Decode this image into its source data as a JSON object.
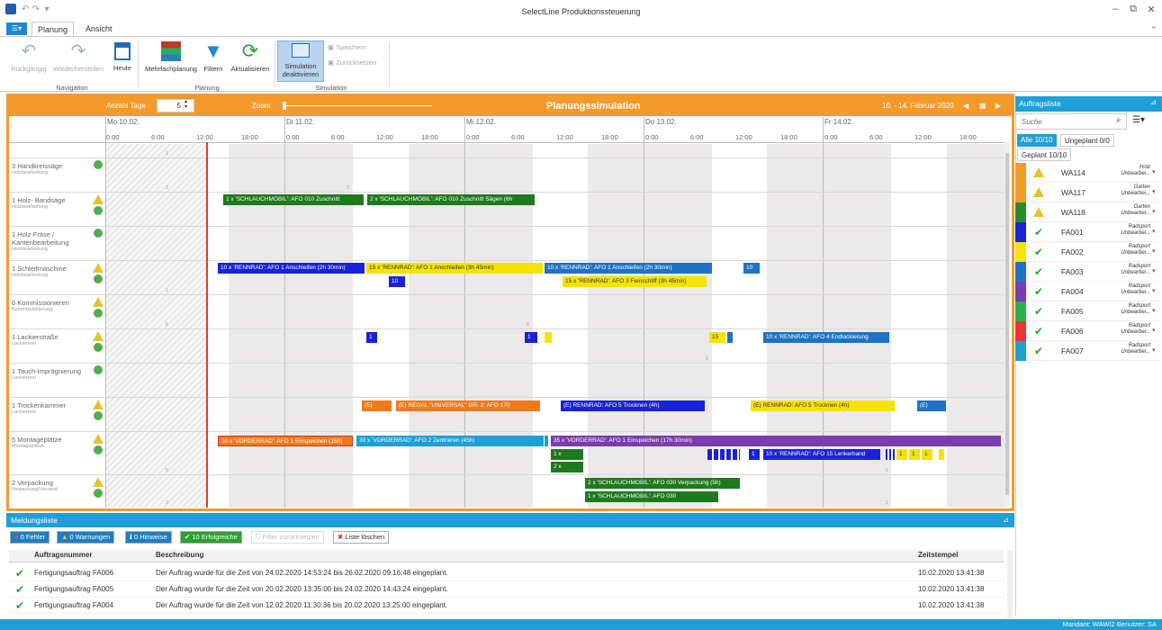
{
  "app": {
    "title": "SelectLine Produktionssteuerung"
  },
  "tabs": [
    "Planung",
    "Ansicht"
  ],
  "ribbon": {
    "nav": {
      "undo": "Rückgängig",
      "redo": "Wiederherstellen",
      "today": "Heute",
      "label": "Navigation"
    },
    "plan": {
      "multi": "Mehrfachplanung",
      "filter": "Filtern",
      "refresh": "Aktualisieren",
      "label": "Planung"
    },
    "sim": {
      "deactivate_1": "Simulation",
      "deactivate_2": "deaktivieren",
      "save": "Speichern",
      "reset": "Zurücksetzen",
      "label": "Simulation"
    }
  },
  "planner": {
    "days_label": "Anzahl Tage",
    "days_value": "5",
    "zoom_label": "Zoom",
    "title": "Planungssimulation",
    "range": "10. - 14. Februar 2020",
    "days": [
      "Mo 10.02.",
      "Di 11.02.",
      "Mi 12.02.",
      "Do 13.02.",
      "Fr 14.02."
    ],
    "hours": [
      "0:00",
      "6:00",
      "12:00",
      "18:00"
    ]
  },
  "resources": [
    {
      "name": "3 Handkreissäge",
      "group": "Holzbearbeitung",
      "status": "ok"
    },
    {
      "name": "1 Holz- Bandsäge",
      "group": "Holzbearbeitung",
      "status": "warn"
    },
    {
      "name": "1 Holz-Fräse / Kantenbearbeitung",
      "group": "Holzbearbeitung",
      "status": "ok"
    },
    {
      "name": "1 Schleifmaschine",
      "group": "Holzbearbeitung",
      "status": "warn"
    },
    {
      "name": "6 Kommissionieren",
      "group": "Kommissionierung",
      "status": "warn"
    },
    {
      "name": "1 Lackierstraße",
      "group": "Lackiererei",
      "status": "warn"
    },
    {
      "name": "1 Tauch-Imprägnierung",
      "group": "Lackiererei",
      "status": "ok"
    },
    {
      "name": "1 Trockenkammer",
      "group": "Lackiererei",
      "status": "warn"
    },
    {
      "name": "5 Montageplätze",
      "group": "Montageplätze",
      "status": "warn"
    },
    {
      "name": "2 Verpackung",
      "group": "Verpackung/Versand",
      "status": "warn"
    }
  ],
  "bars": {
    "b1": "1 x 'SCHLAUCHMOBIL': AFO 010 Zuschnitt",
    "b2": "2 x 'SCHLAUCHMOBIL': AFO 010 Zuschnitt Sägen (6h",
    "b3": "10 x 'RENNRAD': AFO 1 Anschleifen (2h 30min)",
    "b4": "15 x 'RENNRAD': AFO 1 Anschleifen (3h 45min)",
    "b5": "10 x 'RENNRAD': AFO 1 Anschleifen (2h 30min)",
    "b6": "10",
    "b7": "10",
    "b8": "15 x 'RENNRAD': AFO 3 Feinschliff (3h 45min)",
    "b9": "1",
    "b10": "1",
    "b11": "15",
    "b12": "10 x 'RENNRAD': AFO 4 Endlackierung",
    "b13": "(E)",
    "b14": "(E) REGAL \"UNIVERSAL\" GR. 2: AFO 170",
    "b15": "(E) RENNRAD: AFO 5 Trocknen (4h)",
    "b16": "(E) RENNRAD: AFO 5 Trocknen (4h)",
    "b17": "(E)",
    "b18": "30 x 'VORDERRAD': AFO 1 Einspeichen (15h)",
    "b19": "30 x 'VORDERRAD': AFO 2 Zentrieren (45h)",
    "b20": "35 x 'VORDERRAD': AFO 1 Einspeichen (17h 30min)",
    "b21": "1 x",
    "b22": "2 x",
    "b23": "1",
    "b24": "10 x 'RENNRAD': AFO 15 Lenkerband",
    "b25": "1",
    "b26": "1",
    "b27": "1",
    "b28": "2 x 'SCHLAUCHMOBIL': AFO 030 Verpackung (5h)",
    "b29": "1 x 'SCHLAUCHMOBIL': AFO 030"
  },
  "ticks": {
    "t_one": "1",
    "t_three": "3",
    "t_six": "6",
    "t_five": "5",
    "t_two": "2"
  },
  "orders": {
    "title": "Auftragsliste",
    "search_placeholder": "Suche",
    "filter_all": "Alle 10/10",
    "filter_unplanned": "Ungeplant 0/0",
    "filter_planned": "Geplant 10/10",
    "items": [
      {
        "code": "WA114",
        "cat": "Holz",
        "sub": "Unbearbei...",
        "status": "warn",
        "color": "#f39a2b"
      },
      {
        "code": "WA117",
        "cat": "Garten",
        "sub": "Unbearbei...",
        "status": "warn",
        "color": "#f39a2b"
      },
      {
        "code": "WA118",
        "cat": "Garten",
        "sub": "Unbearbei...",
        "status": "warn",
        "color": "#2a8a2a"
      },
      {
        "code": "FA001",
        "cat": "Radsport",
        "sub": "Unbearbei...",
        "status": "ok",
        "color": "#1a22d8"
      },
      {
        "code": "FA002",
        "cat": "Radsport",
        "sub": "Unbearbei...",
        "status": "ok",
        "color": "#f5e300"
      },
      {
        "code": "FA003",
        "cat": "Radsport",
        "sub": "Unbearbei...",
        "status": "ok",
        "color": "#1f72c4"
      },
      {
        "code": "FA004",
        "cat": "Radsport",
        "sub": "Unbearbei...",
        "status": "ok",
        "color": "#7a3cb0"
      },
      {
        "code": "FA005",
        "cat": "Radsport",
        "sub": "Unbearbei...",
        "status": "ok",
        "color": "#27b34a"
      },
      {
        "code": "FA006",
        "cat": "Radsport",
        "sub": "Unbearbei...",
        "status": "ok",
        "color": "#e53935"
      },
      {
        "code": "FA007",
        "cat": "Radsport",
        "sub": "Unbearbei...",
        "status": "ok",
        "color": "#1e9fd6"
      }
    ]
  },
  "messages": {
    "title": "Meldungsliste",
    "filters": {
      "errors": "0 Fehler",
      "warnings": "0 Warnungen",
      "hints": "0 Hinweise",
      "success": "10 Erfolgreiche",
      "reset": "Filter zurücksetzen",
      "clear": "Liste löschen"
    },
    "columns": {
      "order": "Auftragsnummer",
      "desc": "Beschreibung",
      "time": "Zeitstempel"
    },
    "rows": [
      {
        "order": "Fertigungsauftrag FA006",
        "desc": "Der Auftrag wurde für die Zeit von 24.02.2020 14:53:24 bis 26.02.2020 09:16:48 eingeplant.",
        "time": "10.02.2020 13:41:38"
      },
      {
        "order": "Fertigungsauftrag FA005",
        "desc": "Der Auftrag wurde für die Zeit von 20.02.2020 13:35:00 bis 24.02.2020 14:43:24 eingeplant.",
        "time": "10.02.2020 13:41:38"
      },
      {
        "order": "Fertigungsauftrag FA004",
        "desc": "Der Auftrag wurde für die Zeit von 12.02.2020 11:30:36 bis 20.02.2020 13:25:00 eingeplant.",
        "time": "10.02.2020 13:41:38"
      }
    ]
  },
  "status": {
    "text": "Mandant: WAWI2   Benutzer: SA"
  }
}
